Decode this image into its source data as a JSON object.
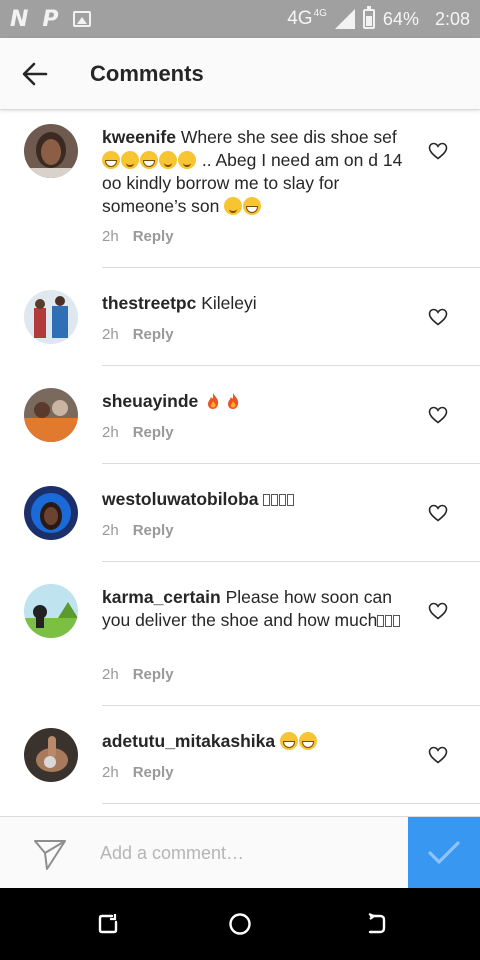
{
  "status_bar": {
    "network": "4G",
    "network_sup": "4G",
    "battery": "64%",
    "time": "2:08",
    "icons": [
      "n-notification-icon",
      "p-notification-icon",
      "image-notification-icon",
      "signal-icon",
      "battery-icon"
    ]
  },
  "header": {
    "title": "Comments",
    "back_icon": "arrow-left-icon"
  },
  "comments": [
    {
      "username": "kweenife",
      "text": "Where she see dis shoe sef",
      "text2": ".. Abeg I need am on d 14 oo kindly borrow me to slay for someone’s son",
      "time": "2h",
      "reply": "Reply"
    },
    {
      "username": "thestreetpc",
      "text": "Kileleyi",
      "time": "2h",
      "reply": "Reply"
    },
    {
      "username": "sheuayinde",
      "text": "",
      "time": "2h",
      "reply": "Reply"
    },
    {
      "username": "westoluwatobiloba",
      "text": "",
      "time": "2h",
      "reply": "Reply"
    },
    {
      "username": "karma_certain",
      "text": "Please how soon can you deliver the shoe and how much",
      "time": "2h",
      "reply": "Reply"
    },
    {
      "username": "adetutu_mitakashika",
      "text": "",
      "time": "2h",
      "reply": "Reply"
    }
  ],
  "input": {
    "placeholder": "Add a comment…",
    "value": ""
  },
  "colors": {
    "status_bar": "#a0a0a0",
    "accent": "#3897f0",
    "text": "#262626",
    "muted": "#999999",
    "divider": "#dbdbdb"
  },
  "nav": {
    "icons": [
      "recent-apps-icon",
      "home-icon",
      "back-nav-icon"
    ]
  }
}
